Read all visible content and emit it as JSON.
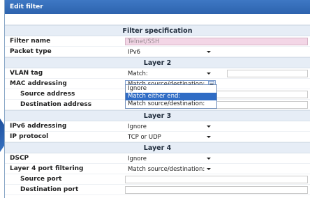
{
  "dialog": {
    "title": "Edit filter"
  },
  "sections": {
    "spec": "Filter specification",
    "layer2": "Layer 2",
    "layer3": "Layer 3",
    "layer4": "Layer 4"
  },
  "fields": {
    "filter_name": {
      "label": "Filter name",
      "value": "Telnet/SSH"
    },
    "packet_type": {
      "label": "Packet type",
      "value": "IPv6"
    },
    "vlan_tag": {
      "label": "VLAN tag",
      "value": "Match:"
    },
    "mac_addressing": {
      "label": "MAC addressing",
      "value": "Match source/destination:"
    },
    "source_address": {
      "label": "Source address"
    },
    "destination_address": {
      "label": "Destination address"
    },
    "ipv6_addressing": {
      "label": "IPv6 addressing",
      "value": "Ignore"
    },
    "ip_protocol": {
      "label": "IP protocol",
      "value": "TCP or UDP"
    },
    "dscp": {
      "label": "DSCP",
      "value": "Ignore"
    },
    "l4_filtering": {
      "label": "Layer 4 port filtering",
      "value": "Match source/destination:"
    },
    "source_port": {
      "label": "Source port"
    },
    "destination_port": {
      "label": "Destination port"
    }
  },
  "mac_dropdown": {
    "options": [
      "Ignore",
      "Match either end:",
      "Match source/destination:"
    ],
    "highlighted_index": 1
  },
  "colors": {
    "titlebar": "#2d63ae",
    "section_bg": "#e6edf6",
    "highlight": "#2f6cc5",
    "pink_field": "#f3d6e6"
  }
}
